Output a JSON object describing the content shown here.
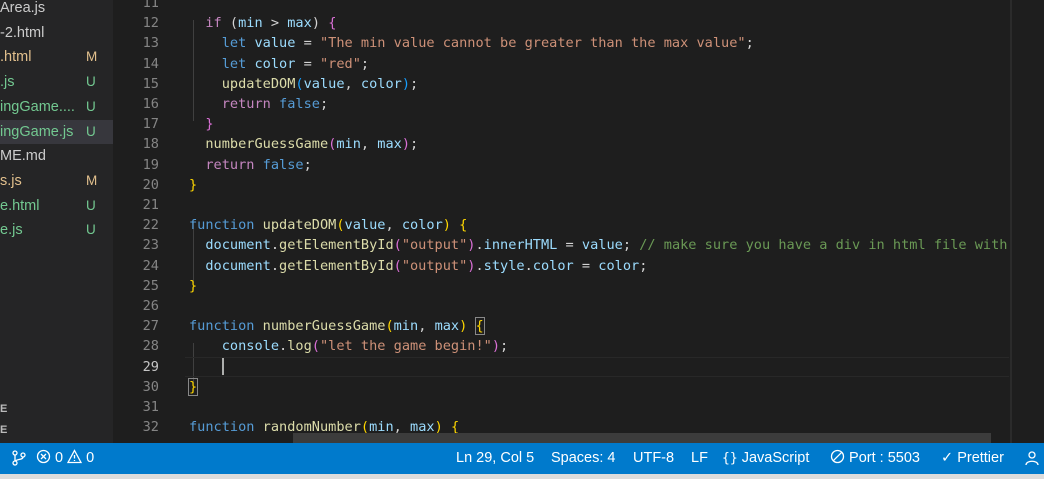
{
  "sidebar": {
    "files": [
      {
        "name": "Area.js",
        "status": "",
        "color": "plain"
      },
      {
        "name": "-2.html",
        "status": "",
        "color": "plain"
      },
      {
        "name": ".html",
        "status": "M",
        "color": "mod"
      },
      {
        "name": ".js",
        "status": "U",
        "color": "untracked"
      },
      {
        "name": "ingGame....",
        "status": "U",
        "color": "untracked"
      },
      {
        "name": "ingGame.js",
        "status": "U",
        "color": "untracked",
        "selected": true
      },
      {
        "name": "ME.md",
        "status": "",
        "color": "plain"
      },
      {
        "name": "s.js",
        "status": "M",
        "color": "mod"
      },
      {
        "name": "e.html",
        "status": "U",
        "color": "untracked"
      },
      {
        "name": "e.js",
        "status": "U",
        "color": "untracked"
      }
    ],
    "section_1": "E",
    "section_2": "E"
  },
  "editor": {
    "active_line": 29,
    "lines": [
      {
        "n": 11,
        "tokens": []
      },
      {
        "n": 12,
        "tokens": [
          [
            "  ",
            "p"
          ],
          [
            "if",
            "kw"
          ],
          [
            " (",
            "p"
          ],
          [
            "min",
            "var"
          ],
          [
            " > ",
            "p"
          ],
          [
            "max",
            "var"
          ],
          [
            ") ",
            "p"
          ],
          [
            "{",
            "br2"
          ]
        ]
      },
      {
        "n": 13,
        "tokens": [
          [
            "    ",
            "p"
          ],
          [
            "let",
            "decl"
          ],
          [
            " ",
            "p"
          ],
          [
            "value",
            "var"
          ],
          [
            " = ",
            "p"
          ],
          [
            "\"The min value cannot be greater than the max value\"",
            "str"
          ],
          [
            ";",
            "p"
          ]
        ]
      },
      {
        "n": 14,
        "tokens": [
          [
            "    ",
            "p"
          ],
          [
            "let",
            "decl"
          ],
          [
            " ",
            "p"
          ],
          [
            "color",
            "var"
          ],
          [
            " = ",
            "p"
          ],
          [
            "\"red\"",
            "str"
          ],
          [
            ";",
            "p"
          ]
        ]
      },
      {
        "n": 15,
        "tokens": [
          [
            "    ",
            "p"
          ],
          [
            "updateDOM",
            "fn"
          ],
          [
            "(",
            "br3"
          ],
          [
            "value",
            "var"
          ],
          [
            ", ",
            "p"
          ],
          [
            "color",
            "var"
          ],
          [
            ")",
            "br3"
          ],
          [
            ";",
            "p"
          ]
        ]
      },
      {
        "n": 16,
        "tokens": [
          [
            "    ",
            "p"
          ],
          [
            "return",
            "kw"
          ],
          [
            " ",
            "p"
          ],
          [
            "false",
            "decl"
          ],
          [
            ";",
            "p"
          ]
        ]
      },
      {
        "n": 17,
        "tokens": [
          [
            "  ",
            "p"
          ],
          [
            "}",
            "br2"
          ]
        ]
      },
      {
        "n": 18,
        "tokens": [
          [
            "  ",
            "p"
          ],
          [
            "numberGuessGame",
            "fn"
          ],
          [
            "(",
            "br2"
          ],
          [
            "min",
            "var"
          ],
          [
            ", ",
            "p"
          ],
          [
            "max",
            "var"
          ],
          [
            ")",
            "br2"
          ],
          [
            ";",
            "p"
          ]
        ]
      },
      {
        "n": 19,
        "tokens": [
          [
            "  ",
            "p"
          ],
          [
            "return",
            "kw"
          ],
          [
            " ",
            "p"
          ],
          [
            "false",
            "decl"
          ],
          [
            ";",
            "p"
          ]
        ]
      },
      {
        "n": 20,
        "tokens": [
          [
            "}",
            "br1"
          ]
        ]
      },
      {
        "n": 21,
        "tokens": []
      },
      {
        "n": 22,
        "tokens": [
          [
            "function",
            "decl"
          ],
          [
            " ",
            "p"
          ],
          [
            "updateDOM",
            "fn"
          ],
          [
            "(",
            "br1"
          ],
          [
            "value",
            "var"
          ],
          [
            ", ",
            "p"
          ],
          [
            "color",
            "var"
          ],
          [
            ")",
            "br1"
          ],
          [
            " ",
            "p"
          ],
          [
            "{",
            "br1"
          ]
        ]
      },
      {
        "n": 23,
        "tokens": [
          [
            "  ",
            "p"
          ],
          [
            "document",
            "var"
          ],
          [
            ".",
            "p"
          ],
          [
            "getElementById",
            "fn"
          ],
          [
            "(",
            "br2"
          ],
          [
            "\"output\"",
            "str"
          ],
          [
            ")",
            "br2"
          ],
          [
            ".",
            "p"
          ],
          [
            "innerHTML",
            "var"
          ],
          [
            " = ",
            "p"
          ],
          [
            "value",
            "var"
          ],
          [
            "; ",
            "p"
          ],
          [
            "// make sure you have a div in html file with",
            "cm"
          ]
        ]
      },
      {
        "n": 24,
        "tokens": [
          [
            "  ",
            "p"
          ],
          [
            "document",
            "var"
          ],
          [
            ".",
            "p"
          ],
          [
            "getElementById",
            "fn"
          ],
          [
            "(",
            "br2"
          ],
          [
            "\"output\"",
            "str"
          ],
          [
            ")",
            "br2"
          ],
          [
            ".",
            "p"
          ],
          [
            "style",
            "var"
          ],
          [
            ".",
            "p"
          ],
          [
            "color",
            "var"
          ],
          [
            " = ",
            "p"
          ],
          [
            "color",
            "var"
          ],
          [
            ";",
            "p"
          ]
        ]
      },
      {
        "n": 25,
        "tokens": [
          [
            "}",
            "br1"
          ]
        ]
      },
      {
        "n": 26,
        "tokens": []
      },
      {
        "n": 27,
        "tokens": [
          [
            "function",
            "decl"
          ],
          [
            " ",
            "p"
          ],
          [
            "numberGuessGame",
            "fn"
          ],
          [
            "(",
            "br1"
          ],
          [
            "min",
            "var"
          ],
          [
            ", ",
            "p"
          ],
          [
            "max",
            "var"
          ],
          [
            ")",
            "br1"
          ],
          [
            " ",
            "p"
          ],
          [
            "{",
            "br1"
          ]
        ]
      },
      {
        "n": 28,
        "tokens": [
          [
            "    ",
            "p"
          ],
          [
            "console",
            "var"
          ],
          [
            ".",
            "p"
          ],
          [
            "log",
            "fn"
          ],
          [
            "(",
            "br2"
          ],
          [
            "\"let the game begin!\"",
            "str"
          ],
          [
            ")",
            "br2"
          ],
          [
            ";",
            "p"
          ]
        ]
      },
      {
        "n": 29,
        "tokens": []
      },
      {
        "n": 30,
        "tokens": [
          [
            "}",
            "br1"
          ]
        ]
      },
      {
        "n": 31,
        "tokens": []
      },
      {
        "n": 32,
        "tokens": [
          [
            "function",
            "decl"
          ],
          [
            " ",
            "p"
          ],
          [
            "randomNumber",
            "fn"
          ],
          [
            "(",
            "br1"
          ],
          [
            "min",
            "var"
          ],
          [
            ", ",
            "p"
          ],
          [
            "max",
            "var"
          ],
          [
            ")",
            "br1"
          ],
          [
            " ",
            "p"
          ],
          [
            "{",
            "br1"
          ]
        ]
      }
    ]
  },
  "statusbar": {
    "remote_icon": "git-branch-icon",
    "errors": "0",
    "warnings": "0",
    "position": "Ln 29, Col 5",
    "spaces": "Spaces: 4",
    "encoding": "UTF-8",
    "eol": "LF",
    "language": "JavaScript",
    "port": "Port : 5503",
    "prettier": "Prettier",
    "background": "#007acc"
  }
}
